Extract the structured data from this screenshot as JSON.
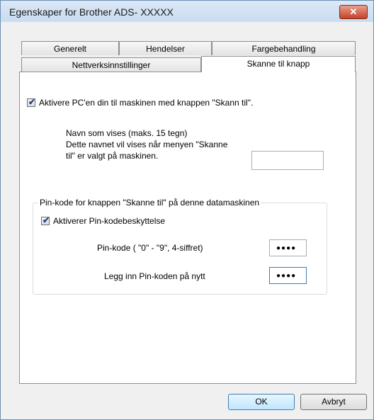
{
  "window": {
    "title": "Egenskaper for Brother ADS- XXXXX",
    "close_glyph": "✕"
  },
  "tabs": {
    "row1": [
      "Generelt",
      "Hendelser",
      "Fargebehandling"
    ],
    "row2": [
      "Nettverksinnstillinger",
      "Skanne til knapp"
    ],
    "active": "Skanne til knapp"
  },
  "panel": {
    "enable_pc_label": "Aktivere PC'en din til maskinen med knappen \"Skann til\".",
    "enable_pc_checked": true,
    "display_name_line1": "Navn som vises (maks. 15 tegn)",
    "display_name_line2": "Dette navnet vil vises når menyen \"Skanne",
    "display_name_line3": "til\" er valgt på maskinen.",
    "display_name_value": "",
    "pin_group_title": "Pin-kode for knappen \"Skanne til\" på denne datamaskinen",
    "pin_protect_label": "Aktiverer Pin-kodebeskyttelse",
    "pin_protect_checked": true,
    "pin_label": "Pin-kode ( \"0\" - \"9\", 4-siffret)",
    "pin_value_masked": "●●●●",
    "pin_confirm_label": "Legg inn Pin-koden på nytt",
    "pin_confirm_masked": "●●●●"
  },
  "buttons": {
    "ok": "OK",
    "cancel": "Avbryt"
  },
  "icons": {
    "checkmark": "✔"
  }
}
